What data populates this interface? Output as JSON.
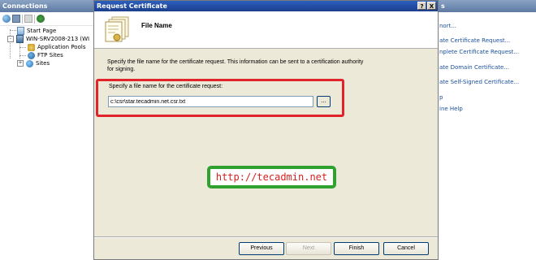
{
  "connections": {
    "title": "Connections",
    "toolbar_icons": [
      "globe-connect-icon",
      "save-icon",
      "up-icon",
      "connect-icon"
    ],
    "tree": [
      {
        "label": "Start Page",
        "icon": "start-page-icon"
      },
      {
        "label": "WIN-SRV2008-213 (WI",
        "icon": "server-icon",
        "expander": "-"
      },
      {
        "label": "Application Pools",
        "icon": "app-pools-icon"
      },
      {
        "label": "FTP Sites",
        "icon": "ftp-sites-icon"
      },
      {
        "label": "Sites",
        "icon": "sites-icon",
        "expander": "+"
      }
    ]
  },
  "actions": {
    "title": "s",
    "items": [
      "nort...",
      "ate Certificate Request...",
      "nplete Certificate Request...",
      "ate Domain Certificate...",
      "ate Self-Signed Certificate...",
      "p",
      "ine Help"
    ]
  },
  "dialog": {
    "title": "Request Certificate",
    "help_button": "?",
    "close_button": "X",
    "banner_title": "File Name",
    "description": "Specify the file name for the certificate request. This information can be sent to a certification authority for signing.",
    "field_label": "Specify a file name for the certificate request:",
    "file_value": "c:\\csr\\star.tecadmin.net.csr.txt",
    "browse_label": "...",
    "buttons": {
      "previous": "Previous",
      "next": "Next",
      "finish": "Finish",
      "cancel": "Cancel"
    }
  },
  "watermark": "http://tecadmin.net",
  "colors": {
    "highlight_border": "#e0242a",
    "watermark_border": "#2fa12f",
    "watermark_text": "#d62020",
    "title_bar": "#2c5fbd"
  }
}
